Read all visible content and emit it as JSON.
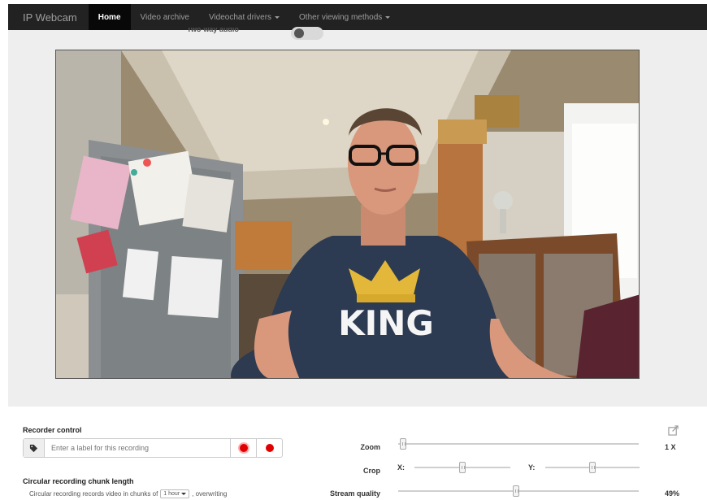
{
  "navbar": {
    "brand": "IP Webcam",
    "items": [
      {
        "label": "Home",
        "active": true,
        "dropdown": false
      },
      {
        "label": "Video archive",
        "active": false,
        "dropdown": false
      },
      {
        "label": "Videochat drivers",
        "active": false,
        "dropdown": true
      },
      {
        "label": "Other viewing methods",
        "active": false,
        "dropdown": true
      }
    ]
  },
  "audio": {
    "two_way_label": "Two-way audio",
    "toggle_on": false
  },
  "video": {
    "shirt_text": "KING",
    "icon": "camera-feed"
  },
  "recorder": {
    "title": "Recorder control",
    "label_placeholder": "Enter a label for this recording",
    "tag_icon": "tag-icon",
    "burst_icon": "burst-record-icon",
    "record_icon": "record-icon"
  },
  "chunk": {
    "title": "Circular recording chunk length",
    "text_before": "Circular recording records video in chunks of",
    "selected": "1 hour",
    "text_after": ", overwriting"
  },
  "controls": {
    "zoom": {
      "label": "Zoom",
      "level": 0.02,
      "value": "1 X"
    },
    "crop": {
      "label": "Crop",
      "x_label": "X:",
      "y_label": "Y:",
      "x_level": 0.5,
      "y_level": 0.5
    },
    "stream_quality": {
      "label": "Stream quality",
      "level": 0.49,
      "value": "49%"
    }
  },
  "colors": {
    "navbar_bg": "#222222",
    "active_bg": "#080808",
    "record_red": "#e00000",
    "band_bg": "#eeeeee"
  }
}
